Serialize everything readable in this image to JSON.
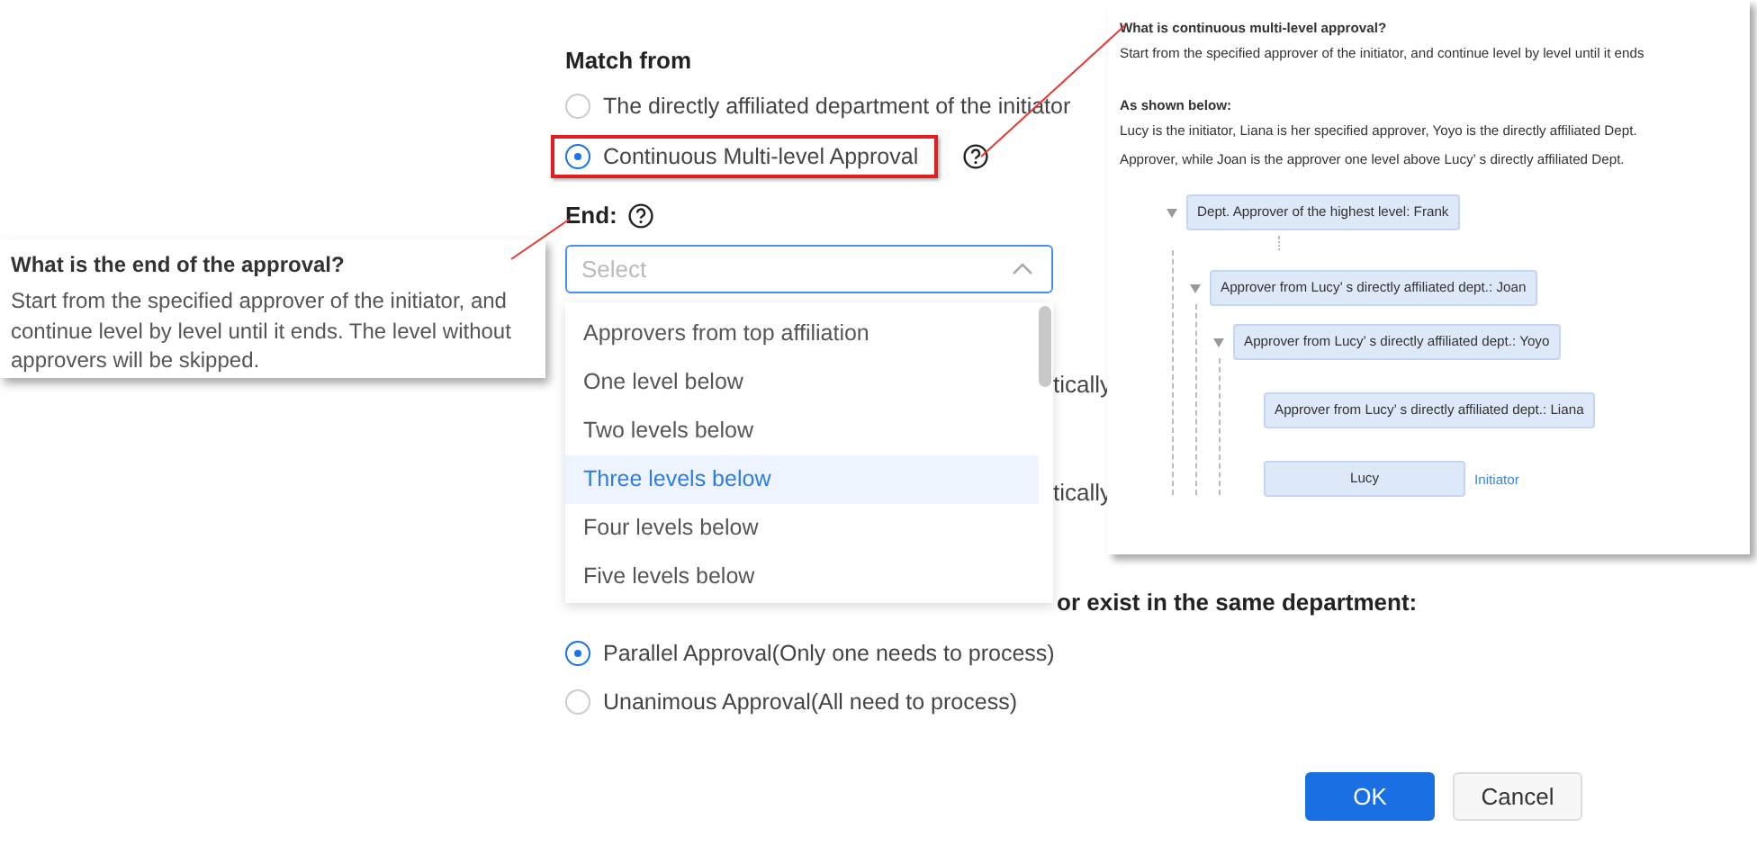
{
  "form": {
    "match_label": "Match from",
    "match_options": [
      {
        "label": "The directly affiliated department of the initiator",
        "selected": false,
        "highlighted": false,
        "help": false
      },
      {
        "label": "Continuous Multi-level Approval",
        "selected": true,
        "highlighted": true,
        "help": true
      }
    ],
    "end_label": "End:",
    "end_select": {
      "placeholder": "Select",
      "expanded": true
    },
    "hidden_fragments": [
      "tically",
      "tically"
    ],
    "multi_heading": "or exist in the same department:",
    "multi_options": [
      {
        "label": "Parallel Approval(Only one needs to process)",
        "selected": true
      },
      {
        "label": "Unanimous Approval(All need to process)",
        "selected": false
      }
    ],
    "buttons": [
      {
        "label": "OK",
        "kind": "primary"
      },
      {
        "label": "Cancel",
        "kind": "default"
      }
    ]
  },
  "dropdown": {
    "options": [
      {
        "label": "Approvers from top affiliation",
        "selected": false
      },
      {
        "label": "One level below",
        "selected": false
      },
      {
        "label": "Two levels below",
        "selected": false
      },
      {
        "label": "Three levels below",
        "selected": true
      },
      {
        "label": "Four levels below",
        "selected": false
      },
      {
        "label": "Five levels below",
        "selected": false
      }
    ]
  },
  "end_tooltip": {
    "title": "What is the end of the approval?",
    "text": "Start from the specified approver of the initiator, and continue level by level until it ends. The level without approvers will be skipped."
  },
  "continuous_help": {
    "title": "What is continuous multi-level approval?",
    "intro": "Start from the specified approver of the initiator, and continue level by level until it ends",
    "example_title": "As shown below:",
    "example_lines": [
      "Lucy is the initiator, Liana is her specified approver, Yoyo is the directly affiliated Dept.",
      "Approver, while Joan is the approver one level above Lucy’ s directly affiliated Dept."
    ],
    "tree": [
      {
        "label": "Dept. Approver of the highest level: Frank",
        "expanded": true,
        "ellipsis_after": true,
        "children": [
          {
            "label": "Approver from Lucy’ s directly affiliated dept.: Joan",
            "expanded": true,
            "children": [
              {
                "label": "Approver from Lucy’ s directly affiliated dept.: Yoyo",
                "expanded": true,
                "children": [
                  {
                    "label": "Approver from Lucy’ s directly affiliated dept.:  Liana"
                  },
                  {
                    "label": "Lucy",
                    "note": "Initiator"
                  }
                ]
              }
            ]
          }
        ]
      }
    ]
  }
}
